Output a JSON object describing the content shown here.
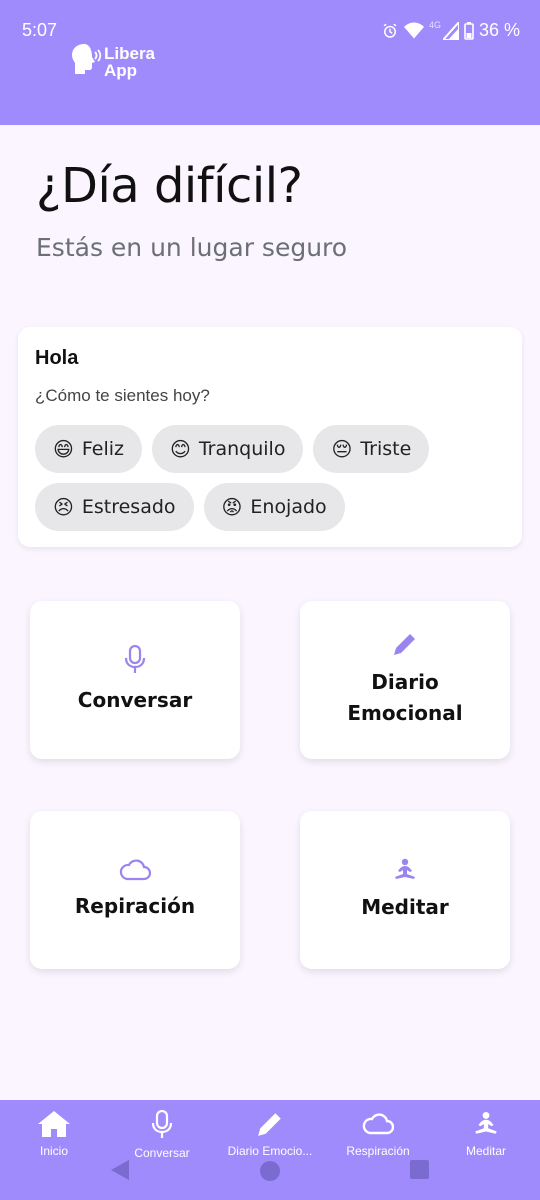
{
  "status_bar": {
    "time": "5:07",
    "network_label": "4G",
    "battery": "36 %",
    "icons": [
      "alarm-icon",
      "wifi-icon",
      "signal-icon",
      "battery-icon"
    ]
  },
  "app": {
    "logo_text": "Libera App"
  },
  "hero": {
    "title": "¿Día difícil?",
    "subtitle": "Estás en un lugar seguro"
  },
  "mood_card": {
    "title": "Hola",
    "question": "¿Cómo te sientes hoy?",
    "moods": [
      {
        "emoji": "😄",
        "label": "Feliz"
      },
      {
        "emoji": "😊",
        "label": "Tranquilo"
      },
      {
        "emoji": "😔",
        "label": "Triste"
      },
      {
        "emoji": "😣",
        "label": "Estresado"
      },
      {
        "emoji": "😡",
        "label": "Enojado"
      }
    ]
  },
  "tiles": [
    {
      "label": "Conversar",
      "icon": "microphone-icon"
    },
    {
      "label": "Diario\nEmocional",
      "icon": "pencil-icon"
    },
    {
      "label": "Repiración",
      "icon": "cloud-icon"
    },
    {
      "label": "Meditar",
      "icon": "meditation-icon"
    }
  ],
  "bottom_nav": {
    "items": [
      {
        "label": "Inicio",
        "icon": "home-icon"
      },
      {
        "label": "Conversar",
        "icon": "microphone-icon"
      },
      {
        "label": "Diario Emocio...",
        "icon": "pencil-icon"
      },
      {
        "label": "Respiración",
        "icon": "cloud-icon"
      },
      {
        "label": "Meditar",
        "icon": "meditation-icon"
      }
    ]
  },
  "colors": {
    "primary": "#a08bfc",
    "background": "#fbf5ff",
    "icon_accent": "#9b84f0",
    "chip_bg": "#e7e7ea"
  }
}
